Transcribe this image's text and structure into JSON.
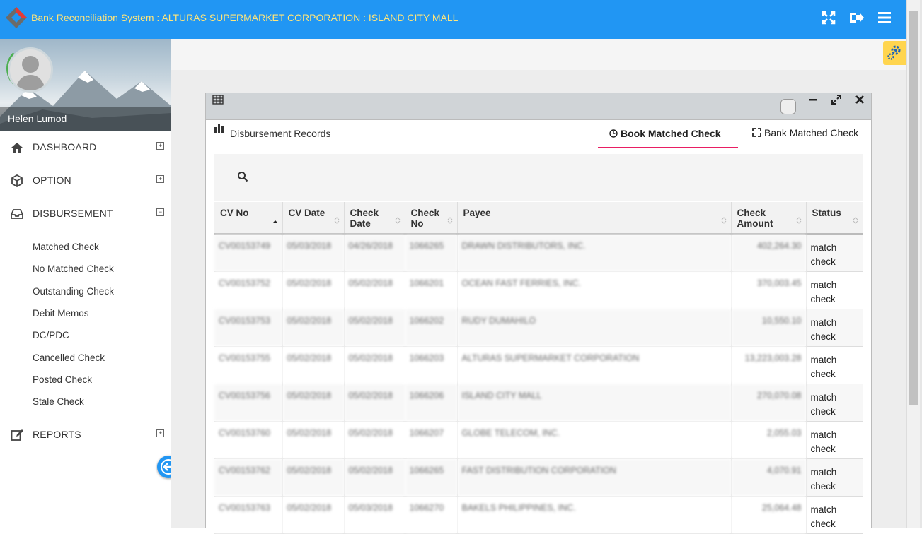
{
  "header": {
    "title": "Bank Reconciliation System : ALTURAS SUPERMARKET CORPORATION : ISLAND CITY MALL",
    "icons": [
      "fullscreen-icon",
      "logout-icon",
      "menu-icon"
    ]
  },
  "sidebar": {
    "username": "Helen Lumod",
    "items": [
      {
        "label": "DASHBOARD",
        "icon": "home-icon",
        "toggle": "+"
      },
      {
        "label": "OPTION",
        "icon": "cube-icon",
        "toggle": "+"
      },
      {
        "label": "DISBURSEMENT",
        "icon": "inbox-icon",
        "toggle": "−"
      },
      {
        "label": "REPORTS",
        "icon": "edit-icon",
        "toggle": "+"
      }
    ],
    "subitems": [
      "Matched Check",
      "No Matched Check",
      "Outstanding Check",
      "Debit Memos",
      "DC/PDC",
      "Cancelled Check",
      "Posted Check",
      "Stale Check"
    ]
  },
  "panel": {
    "title": "Disbursement Records",
    "tabs": {
      "active": "Book Matched Check",
      "other": "Bank Matched Check"
    },
    "table": {
      "columns": [
        "CV No",
        "CV Date",
        "Check Date",
        "Check No",
        "Payee",
        "Check Amount",
        "Status"
      ],
      "rows": [
        [
          "CV00153749",
          "05/03/2018",
          "04/26/2018",
          "1066265",
          "DRAWN DISTRIBUTORS, INC.",
          "402,264.30",
          "match check"
        ],
        [
          "CV00153752",
          "05/02/2018",
          "05/02/2018",
          "1066201",
          "OCEAN FAST FERRIES, INC.",
          "370,003.45",
          "match check"
        ],
        [
          "CV00153753",
          "05/02/2018",
          "05/02/2018",
          "1066202",
          "RUDY DUMAHILO",
          "10,550.10",
          "match check"
        ],
        [
          "CV00153755",
          "05/02/2018",
          "05/02/2018",
          "1066203",
          "ALTURAS SUPERMARKET CORPORATION",
          "13,223,003.28",
          "match check"
        ],
        [
          "CV00153756",
          "05/02/2018",
          "05/02/2018",
          "1066206",
          "ISLAND CITY MALL",
          "270,070.08",
          "match check"
        ],
        [
          "CV00153760",
          "05/02/2018",
          "05/02/2018",
          "1066207",
          "GLOBE TELECOM, INC.",
          "2,055.03",
          "match check"
        ],
        [
          "CV00153762",
          "05/02/2018",
          "05/02/2018",
          "1066265",
          "FAST DISTRIBUTION CORPORATION",
          "4,070.91",
          "match check"
        ],
        [
          "CV00153763",
          "05/02/2018",
          "05/03/2018",
          "1066270",
          "BAKELS PHILIPPINES, INC.",
          "25,064.48",
          "match check"
        ]
      ]
    }
  },
  "colors": {
    "topbar": "#2196f3",
    "title_text": "#ffe57a",
    "active_tab_underline": "#e91e63",
    "gear_button": "#ffd54f"
  }
}
